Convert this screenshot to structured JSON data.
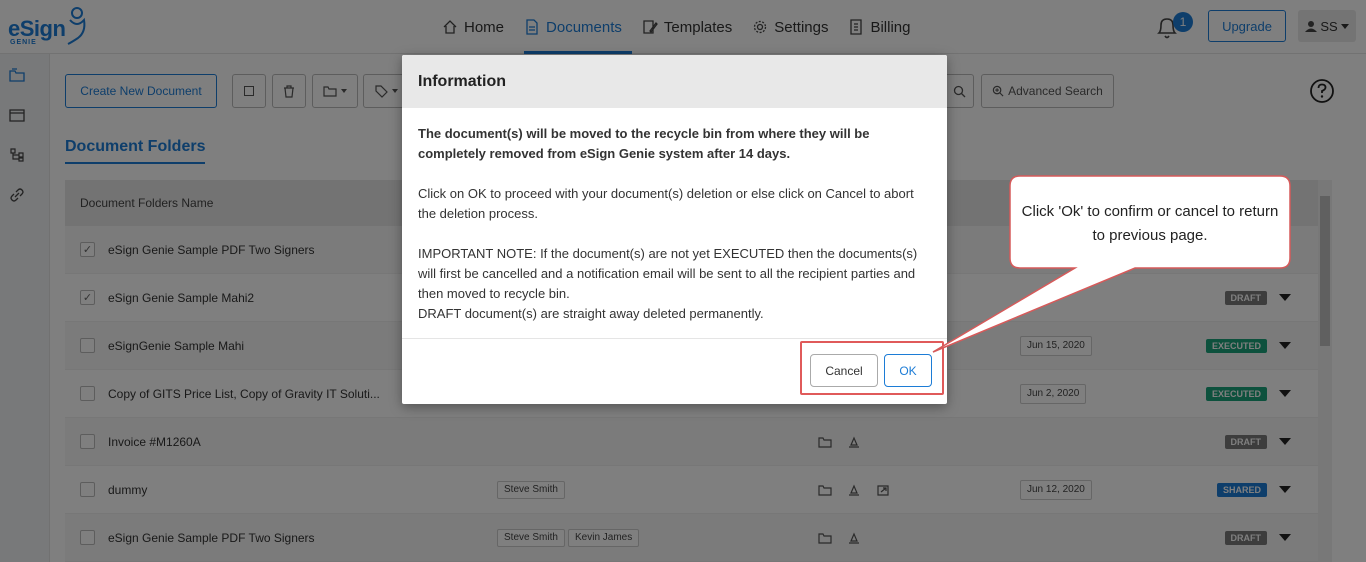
{
  "brand": {
    "name": "eSign",
    "sub": "GENIE"
  },
  "nav": [
    {
      "label": "Home",
      "icon": "home-icon"
    },
    {
      "label": "Documents",
      "icon": "document-icon"
    },
    {
      "label": "Templates",
      "icon": "template-icon"
    },
    {
      "label": "Settings",
      "icon": "gear-icon"
    },
    {
      "label": "Billing",
      "icon": "billing-icon"
    }
  ],
  "notifications": {
    "count": "1"
  },
  "upgrade_label": "Upgrade",
  "user": {
    "initials": "SS"
  },
  "toolbar": {
    "create_label": "Create New Document",
    "advanced_search_label": "Advanced Search"
  },
  "folders_title": "Document Folders",
  "table": {
    "header": "Document Folders Name",
    "rows": [
      {
        "name": "eSign Genie Sample PDF Two Signers",
        "checked": true,
        "tags": [],
        "date": "",
        "status": ""
      },
      {
        "name": "eSign Genie Sample Mahi2",
        "checked": true,
        "tags": [],
        "date": "",
        "status": "DRAFT"
      },
      {
        "name": "eSignGenie Sample Mahi",
        "checked": false,
        "tags": [],
        "date": "Jun 15, 2020",
        "status": "EXECUTED"
      },
      {
        "name": "Copy of GITS Price List, Copy of Gravity IT Soluti...",
        "checked": false,
        "tags": [],
        "date": "Jun 2, 2020",
        "status": "EXECUTED"
      },
      {
        "name": "Invoice #M1260A",
        "checked": false,
        "tags": [],
        "date": "",
        "status": "DRAFT"
      },
      {
        "name": "dummy",
        "checked": false,
        "tags": [
          "Steve Smith"
        ],
        "date": "Jun 12, 2020",
        "status": "SHARED"
      },
      {
        "name": "eSign Genie Sample PDF Two Signers",
        "checked": false,
        "tags": [
          "Steve Smith",
          "Kevin James"
        ],
        "date": "",
        "status": "DRAFT"
      }
    ]
  },
  "status_colors": {
    "DRAFT": "#7a7a7a",
    "EXECUTED": "#1aa37a",
    "SHARED": "#1c7cd6"
  },
  "modal": {
    "title": "Information",
    "bold_text": "The document(s) will be moved to the recycle bin from where they will be completely removed from eSign Genie system after 14 days.",
    "para1": "Click on OK to proceed with your document(s) deletion or else click on Cancel to abort the deletion process.",
    "para2": "IMPORTANT NOTE: If the document(s) are not yet EXECUTED then the documents(s) will first be cancelled and a notification email will be sent to all the recipient parties and then moved to recycle bin.",
    "para3": "DRAFT document(s) are straight away deleted permanently.",
    "cancel_label": "Cancel",
    "ok_label": "OK"
  },
  "callout": {
    "text": "Click 'Ok' to confirm or cancel to return to previous page."
  },
  "colors": {
    "accent": "#1c7cd6",
    "highlight": "#e05a5a"
  }
}
